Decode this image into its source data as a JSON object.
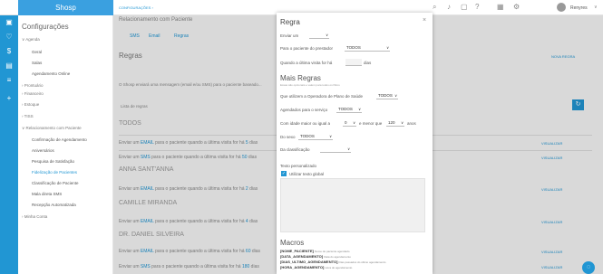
{
  "app": {
    "logo": "Shosp"
  },
  "header": {
    "tab": "CONFIGURAÇÕES",
    "tab_arrow": "›",
    "user": "Renyres",
    "breadcrumb": "Relacionamento com Paciente"
  },
  "sidebar": {
    "title": "Configurações",
    "sections": [
      {
        "label": "∨ Agenda"
      },
      {
        "label": "› Prontuário"
      },
      {
        "label": "› Financeiro"
      },
      {
        "label": "› Estoque"
      },
      {
        "label": "› TISS"
      },
      {
        "label": "∨ Relacionamento com Paciente"
      },
      {
        "label": "› Minha Conta"
      }
    ],
    "agenda_items": [
      "Geral",
      "Salas",
      "Agendamento Online"
    ],
    "rel_items": [
      "Confirmação de Agendamento",
      "Aniversários",
      "Pesquisa de Satisfação",
      "Fidelização de Pacientes",
      "Classificação de Paciente",
      "Mala direta SMS",
      "Recepção Automatizada"
    ]
  },
  "main": {
    "tabs": [
      "SMS",
      "Email",
      "Regras"
    ],
    "heading": "Regras",
    "new_rule": "NOVA REGRA",
    "info": "O Shosp enviará uma mensagem (email e/ou SMS) para o paciente baseado...",
    "list_header": "Lista de regras",
    "groups": [
      {
        "name": "TODOS",
        "rows": [
          {
            "ch": "EMAIL",
            "days": "5"
          },
          {
            "ch": "SMS",
            "days": "50"
          }
        ]
      },
      {
        "name": "ANNA SANT'ANNA",
        "rows": [
          {
            "ch": "EMAIL",
            "days": "2"
          }
        ]
      },
      {
        "name": "CAMILLE MIRANDA",
        "rows": [
          {
            "ch": "EMAIL",
            "days": "4"
          }
        ]
      },
      {
        "name": "DR. DANIEL SILVEIRA",
        "rows": [
          {
            "ch": "EMAIL",
            "days": "60"
          },
          {
            "ch": "SMS",
            "days": "180"
          }
        ]
      }
    ],
    "row_prefix": "Enviar um",
    "row_mid": "para o paciente quando a última visita for há",
    "row_suffix": "dias",
    "visualize": "VISUALIZAR"
  },
  "modal": {
    "title": "Regra",
    "close": "×",
    "send_label": "Enviar um",
    "send_value": "",
    "to_provider_label": "Para o paciente do prestador",
    "to_provider_value": "TODOS",
    "last_visit_label": "Quando a última visita for há",
    "last_visit_suffix": "dias",
    "more_title": "Mais Regras",
    "more_note": "Essas são opcionais e valem para todos os filtros",
    "insurance_label": "Que utilizem a Operadora de Plano de Saúde",
    "insurance_value": "TODOS",
    "service_label": "Agendados para o serviço",
    "service_value": "TODOS",
    "age_label": "Com idade maior ou igual a",
    "age_min": "0",
    "age_mid": "e menor que",
    "age_max": "120",
    "age_suffix": "anos",
    "sex_label": "Do sexo",
    "sex_value": "TODOS",
    "class_label": "Da classificação",
    "class_value": "",
    "custom_text_label": "Texto personalizado",
    "global_text_label": "Utilizar texto global",
    "macros_title": "Macros",
    "macros": [
      {
        "k": "[NOME_PACIENTE]",
        "d": "Nome do paciente agendado"
      },
      {
        "k": "[DATA_AGENDAMENTO]",
        "d": "Data do agendamento"
      },
      {
        "k": "[DIAS_ULTIMO_AGENDAMENTO]",
        "d": "Dias passados do último agendamento"
      },
      {
        "k": "[HORA_AGENDAMENTO]",
        "d": "Hora do agendamento"
      }
    ]
  },
  "colors": {
    "primary": "#2196d3",
    "rail": "#2196d3"
  }
}
